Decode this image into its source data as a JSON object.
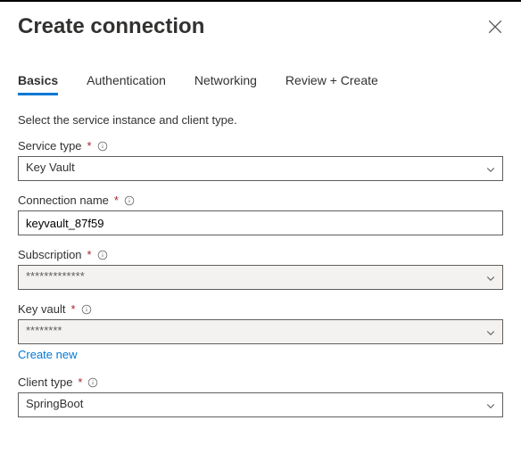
{
  "header": {
    "title": "Create connection"
  },
  "tabs": [
    {
      "label": "Basics"
    },
    {
      "label": "Authentication"
    },
    {
      "label": "Networking"
    },
    {
      "label": "Review + Create"
    }
  ],
  "active_tab_index": 0,
  "intro": "Select the service instance and client type.",
  "fields": {
    "service_type": {
      "label": "Service type",
      "value": "Key Vault"
    },
    "connection_name": {
      "label": "Connection name",
      "value": "keyvault_87f59"
    },
    "subscription": {
      "label": "Subscription",
      "value": "*************"
    },
    "key_vault": {
      "label": "Key vault",
      "value": "********",
      "create_new": "Create new"
    },
    "client_type": {
      "label": "Client type",
      "value": "SpringBoot"
    }
  }
}
